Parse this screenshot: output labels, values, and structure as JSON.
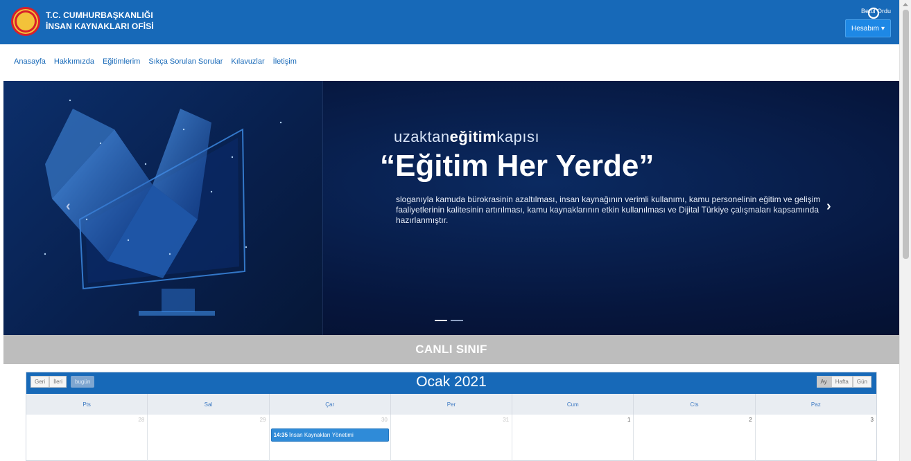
{
  "header": {
    "brand_line1": "T.C. CUMHURBAŞKANLIĞI",
    "brand_line2": "İNSAN KAYNAKLARI OFİSİ",
    "user_name": "Betül Ordu",
    "account_button": "Hesabım"
  },
  "nav": {
    "items": [
      "Anasayfa",
      "Hakkımızda",
      "Eğitimlerim",
      "Sıkça Sorulan Sorular",
      "Kılavuzlar",
      "İletişim"
    ]
  },
  "hero": {
    "sub_part1": "uzaktan",
    "sub_part2": "eğitim",
    "sub_part3": "kapısı",
    "title": "“Eğitim Her Yerde”",
    "text": "sloganıyla kamuda bürokrasinin azaltılması, insan kaynağının verimli kullanımı, kamu personelinin eğitim ve gelişim faaliyetlerinin kalitesinin artırılması, kamu kaynaklarının etkin kullanılması ve Dijital Türkiye çalışmaları kapsamında hazırlanmıştır.",
    "slide_count": 2,
    "active_slide": 1
  },
  "live_class": {
    "label": "CANLI SINIF"
  },
  "calendar": {
    "prev": "Geri",
    "next": "İleri",
    "today": "bugün",
    "title": "Ocak 2021",
    "view_month": "Ay",
    "view_week": "Hafta",
    "view_day": "Gün",
    "days": [
      "Pts",
      "Sal",
      "Çar",
      "Per",
      "Cum",
      "Cts",
      "Paz"
    ],
    "dates": [
      "28",
      "29",
      "30",
      "31",
      "1",
      "2",
      "3"
    ],
    "event": {
      "time": "14:35",
      "title": "İnsan Kaynakları Yönetimi"
    }
  },
  "colors": {
    "header_blue": "#1769b8",
    "hero_dark": "#06163d",
    "band_gray": "#bdbdbd",
    "event_blue": "#2f8bd8"
  }
}
